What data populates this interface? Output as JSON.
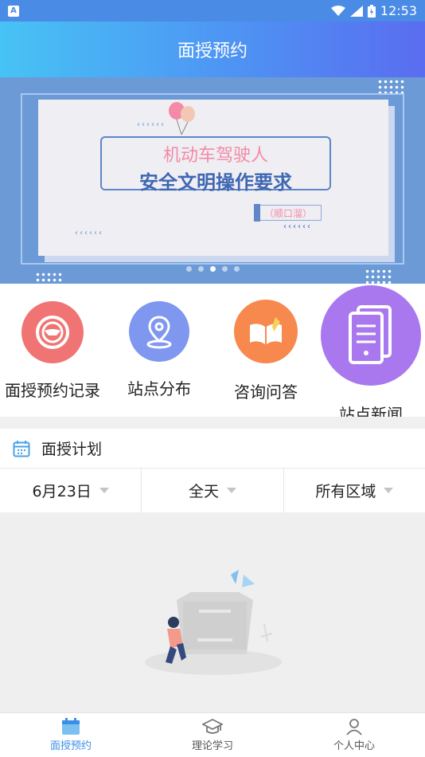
{
  "status_bar": {
    "time": "12:53",
    "app_icon_letter": "A"
  },
  "header": {
    "title": "面授预约"
  },
  "banner": {
    "line1": "机动车驾驶人",
    "line2": "安全文明操作要求",
    "tag": "（顺口溜）",
    "indicator_count": 5,
    "active_indicator": 2
  },
  "quick_actions": [
    {
      "label": "面授预约记录",
      "icon": "steering-wheel-icon",
      "color": "#f07474"
    },
    {
      "label": "站点分布",
      "icon": "location-pin-icon",
      "color": "#7f97ef"
    },
    {
      "label": "咨询问答",
      "icon": "open-book-icon",
      "color": "#f7884e"
    },
    {
      "label": "站点新闻",
      "icon": "document-stack-icon",
      "color": "#a978ef"
    }
  ],
  "plan": {
    "title": "面授计划",
    "icon": "calendar-icon",
    "filters": {
      "date": "6月23日",
      "time": "全天",
      "area": "所有区域"
    }
  },
  "tabbar": [
    {
      "label": "面授预约",
      "icon": "calendar-icon",
      "active": true
    },
    {
      "label": "理论学习",
      "icon": "graduation-cap-icon",
      "active": false
    },
    {
      "label": "个人中心",
      "icon": "person-icon",
      "active": false
    }
  ],
  "colors": {
    "accent": "#3a8ee6",
    "header_start": "#47c3f5",
    "header_end": "#5a6cf0"
  }
}
